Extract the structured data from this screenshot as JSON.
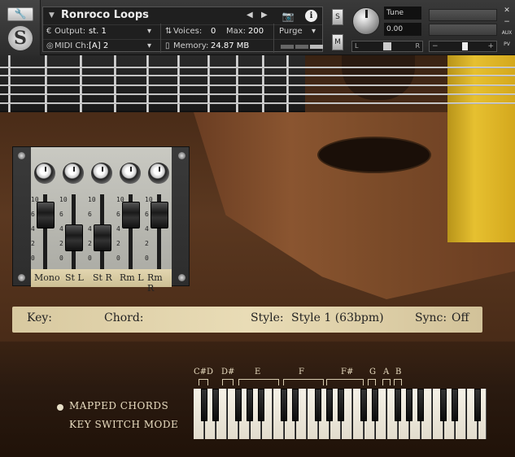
{
  "header": {
    "title": "Ronroco Loops",
    "output_label": "Output:",
    "output_value": "st. 1",
    "midi_label": "MIDI Ch:",
    "midi_value": "[A]  2",
    "voices_label": "Voices:",
    "voices_value": "0",
    "max_label": "Max:",
    "max_value": "200",
    "memory_label": "Memory:",
    "memory_value": "24.87 MB",
    "purge_label": "Purge",
    "solo_label": "S",
    "mute_label": "M",
    "tune_label": "Tune",
    "tune_value": "0.00",
    "pan_left": "L",
    "pan_right": "R",
    "vol_minus": "−",
    "vol_plus": "+",
    "aux_label": "AUX",
    "pv_label": "PV"
  },
  "mixer": {
    "channels": [
      {
        "label": "Mono",
        "level": 0.85
      },
      {
        "label": "St L",
        "level": 0.35
      },
      {
        "label": "St R",
        "level": 0.35
      },
      {
        "label": "Rm L",
        "level": 0.85
      },
      {
        "label": "Rm R",
        "level": 0.85
      }
    ],
    "scale": [
      "10",
      "6",
      "4",
      "2",
      "0"
    ]
  },
  "strip": {
    "key_label": "Key:",
    "chord_label": "Chord:",
    "style_label": "Style:",
    "style_value": "Style 1 (63bpm)",
    "sync_label": "Sync:",
    "sync_value": "Off"
  },
  "legend": {
    "mapped": "MAPPED CHORDS",
    "keyswitch": "KEY SWITCH MODE"
  },
  "keyboard": {
    "notes": [
      "C#",
      "D",
      "D#",
      "E",
      "F",
      "F#",
      "G",
      "A",
      "B"
    ]
  }
}
